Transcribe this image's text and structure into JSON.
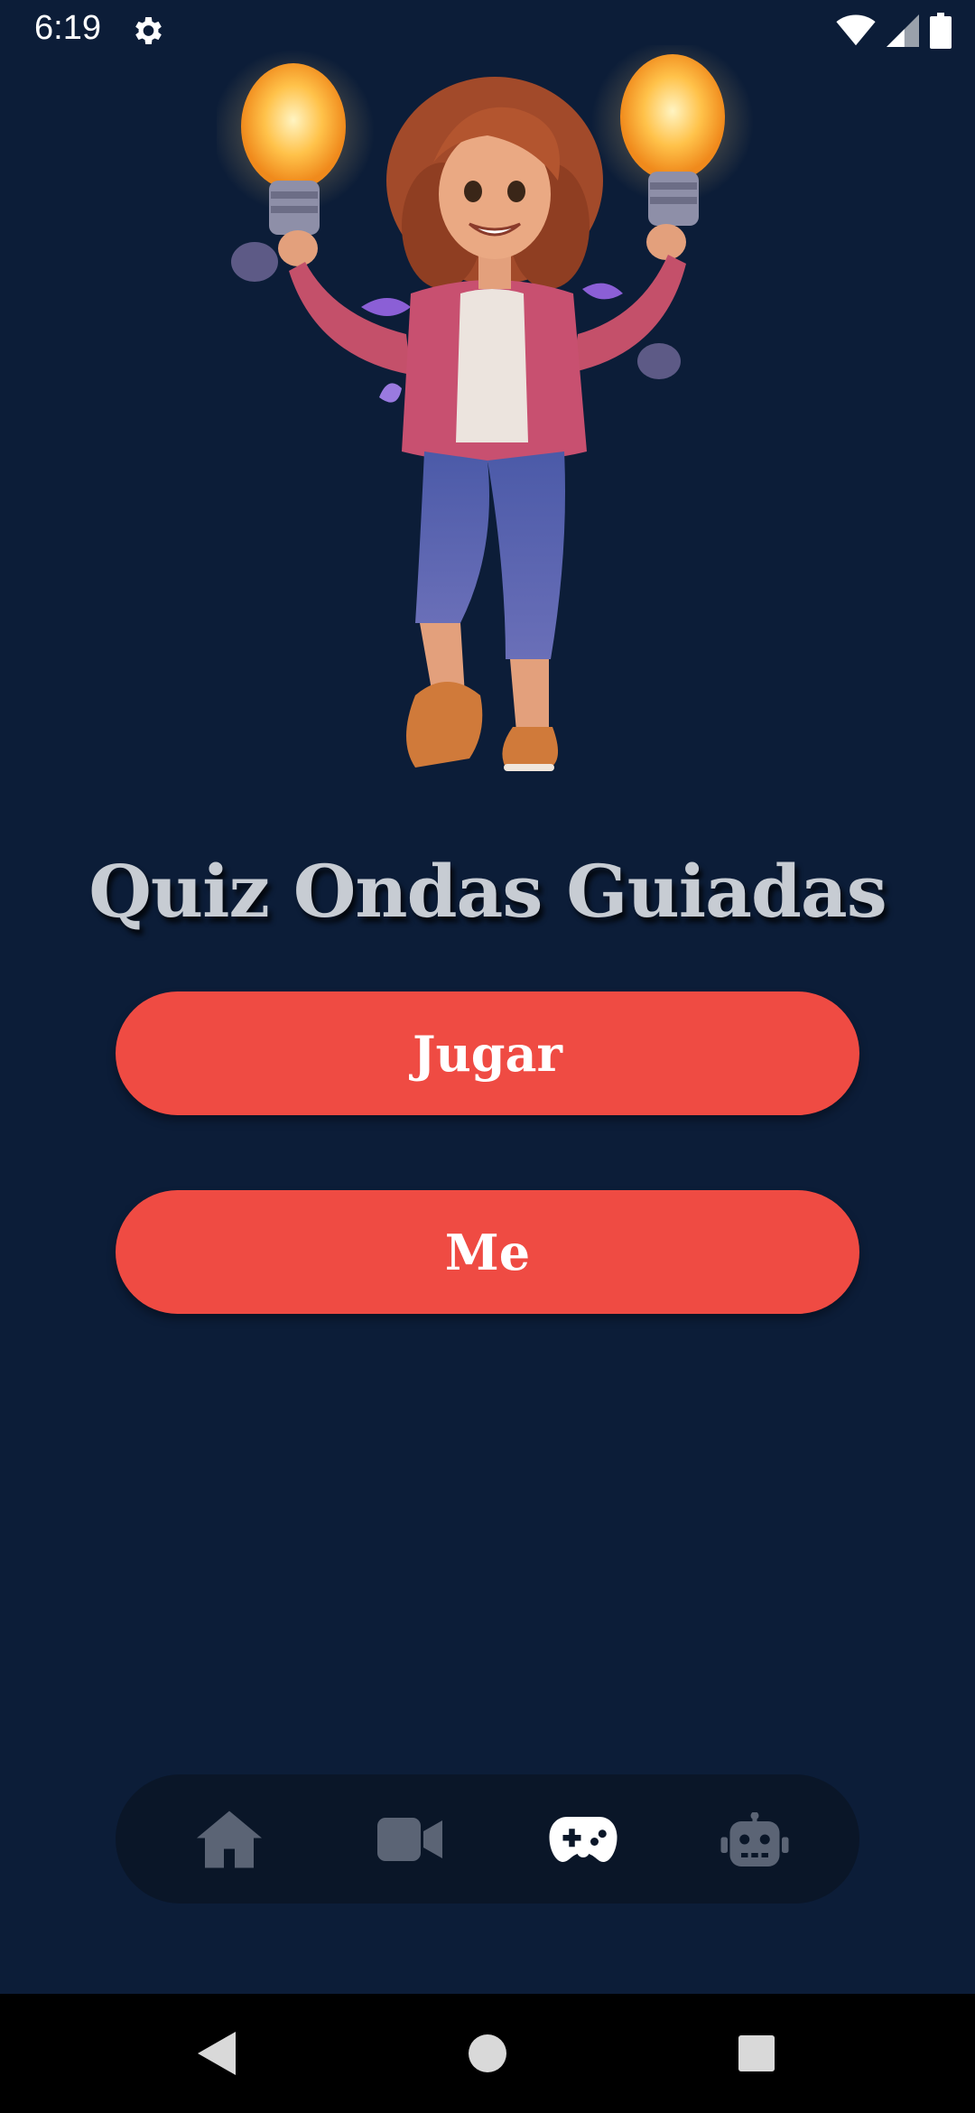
{
  "status_bar": {
    "time": "6:19",
    "icons": [
      "gear-icon",
      "wifi-icon",
      "signal-icon",
      "battery-icon"
    ]
  },
  "hero": {
    "icon": "character-with-lightbulbs-illustration"
  },
  "title": "Quiz Ondas Guiadas",
  "buttons": {
    "play_label": "Jugar",
    "me_label": "Me"
  },
  "bottom_nav": {
    "items": [
      {
        "icon": "home-icon",
        "active": false
      },
      {
        "icon": "video-icon",
        "active": false
      },
      {
        "icon": "gamepad-icon",
        "active": true
      },
      {
        "icon": "robot-icon",
        "active": false
      }
    ]
  },
  "system_nav": {
    "icons": [
      "back-icon",
      "home-circle-icon",
      "recents-icon"
    ]
  },
  "colors": {
    "background": "#0c1d38",
    "button": "#ef4b43",
    "title": "#c7ccd3",
    "nav_bar": "#0a1628",
    "nav_inactive": "#5b6475",
    "nav_active": "#ffffff"
  }
}
